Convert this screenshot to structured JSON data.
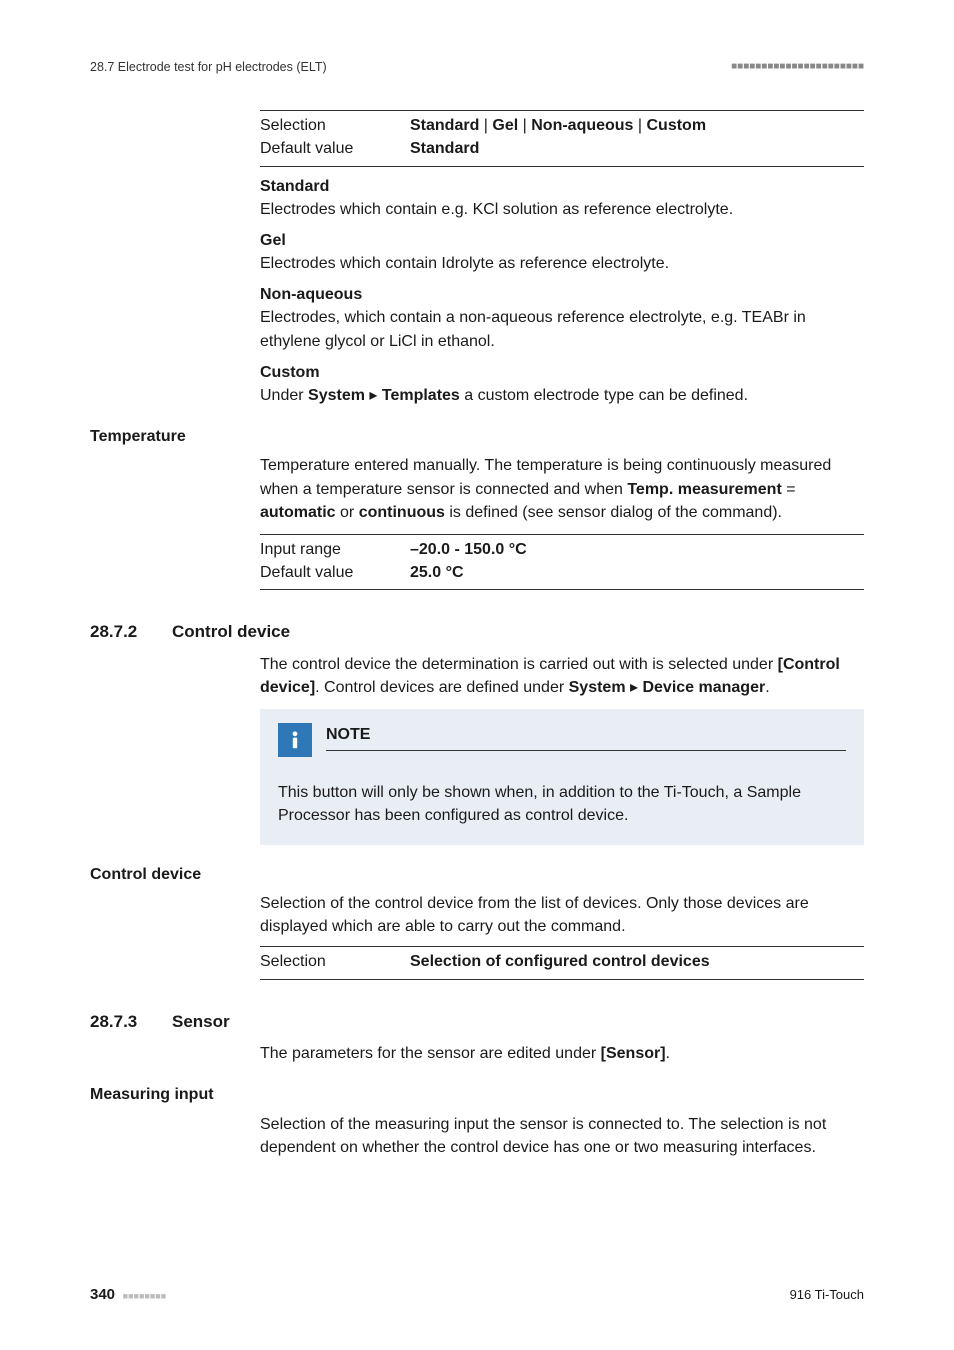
{
  "header": {
    "left": "28.7 Electrode test for pH electrodes (ELT)",
    "right_squares": "■■■■■■■■■■■■■■■■■■■■■■"
  },
  "electrode_type": {
    "rows": {
      "selection_label": "Selection",
      "selection_value_parts": [
        "Standard",
        " | ",
        "Gel",
        " | ",
        "Non-aqueous",
        " | ",
        "Custom"
      ],
      "default_label": "Default value",
      "default_value": "Standard"
    },
    "options": [
      {
        "title": "Standard",
        "body": "Electrodes which contain e.g. KCl solution as reference electrolyte."
      },
      {
        "title": "Gel",
        "body": "Electrodes which contain Idrolyte as reference electrolyte."
      },
      {
        "title": "Non-aqueous",
        "body": "Electrodes, which contain a non-aqueous reference electrolyte, e.g. TEABr in ethylene glycol or LiCl in ethanol."
      },
      {
        "title": "Custom",
        "body_before": "Under ",
        "body_b1": "System",
        "body_mid": " ▸ ",
        "body_b2": "Templates",
        "body_after": " a custom electrode type can be defined."
      }
    ]
  },
  "temperature": {
    "label": "Temperature",
    "body_before": "Temperature entered manually. The temperature is being continuously measured when a temperature sensor is connected and when ",
    "b1": "Temp. measurement",
    "mid1": " = ",
    "b2": "automatic",
    "mid2": " or ",
    "b3": "continuous",
    "body_after": " is defined (see sensor dialog of the command).",
    "rows": {
      "input_label": "Input range",
      "input_value": "–20.0 - 150.0 °C",
      "default_label": "Default value",
      "default_value": "25.0 °C"
    }
  },
  "sec_ctrl": {
    "num": "28.7.2",
    "title": "Control device",
    "intro_before": "The control device the determination is carried out with is selected under ",
    "intro_btn": "[Control device]",
    "intro_mid": ". Control devices are defined under ",
    "intro_b1": "System",
    "intro_arrow": " ▸ ",
    "intro_b2": "Device manager",
    "intro_after": ".",
    "note_title": "NOTE",
    "note_body": "This button will only be shown when, in addition to the Ti-Touch, a Sample Processor has been configured as control device.",
    "field_label": "Control device",
    "field_body": "Selection of the control device from the list of devices. Only those devices are displayed which are able to carry out the command.",
    "rows": {
      "sel_label": "Selection",
      "sel_value": "Selection of configured control devices"
    }
  },
  "sec_sensor": {
    "num": "28.7.3",
    "title": "Sensor",
    "intro_before": "The parameters for the sensor are edited under ",
    "intro_btn": "[Sensor]",
    "intro_after": ".",
    "field_label": "Measuring input",
    "field_body": "Selection of the measuring input the sensor is connected to. The selection is not dependent on whether the control device has one or two measuring interfaces."
  },
  "footer": {
    "page": "340",
    "squares": "■■■■■■■■",
    "right": "916 Ti-Touch"
  }
}
